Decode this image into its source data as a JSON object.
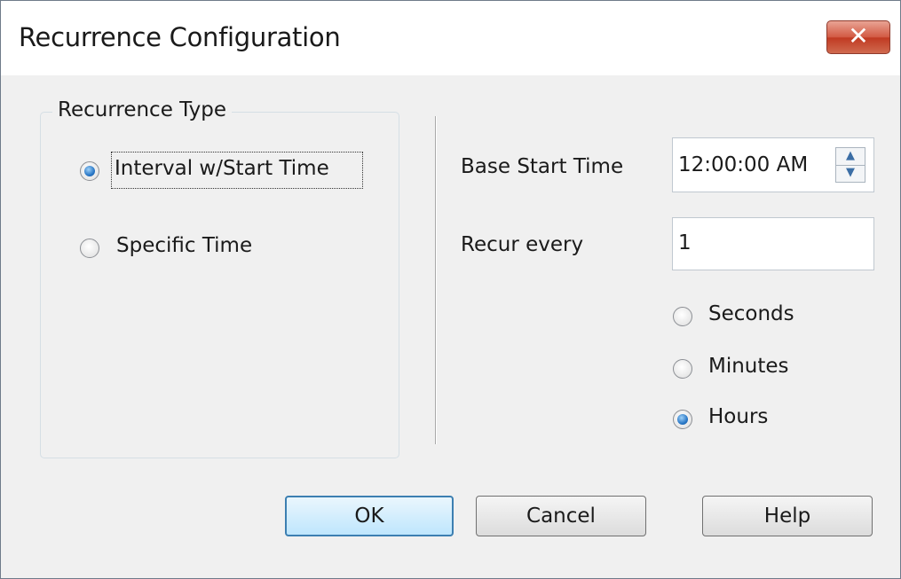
{
  "window": {
    "title": "Recurrence Configuration"
  },
  "recurrence_type": {
    "legend": "Recurrence Type",
    "options": [
      {
        "label": "Interval w/Start Time",
        "selected": true
      },
      {
        "label": "Specific Time",
        "selected": false
      }
    ]
  },
  "base_start_time": {
    "label": "Base Start Time",
    "value": "12:00:00 AM"
  },
  "recur_every": {
    "label": "Recur every",
    "value": "1"
  },
  "units": [
    {
      "label": "Seconds",
      "selected": false
    },
    {
      "label": "Minutes",
      "selected": false
    },
    {
      "label": "Hours",
      "selected": true
    }
  ],
  "buttons": {
    "ok": "OK",
    "cancel": "Cancel",
    "help": "Help"
  },
  "icons": {
    "close": "close-icon",
    "spin_up": "spin-up-icon",
    "spin_down": "spin-down-icon"
  },
  "colors": {
    "close_button": "#d25a43",
    "radio_selected": "#2a78c7",
    "default_button_border": "#3c7fb1"
  }
}
